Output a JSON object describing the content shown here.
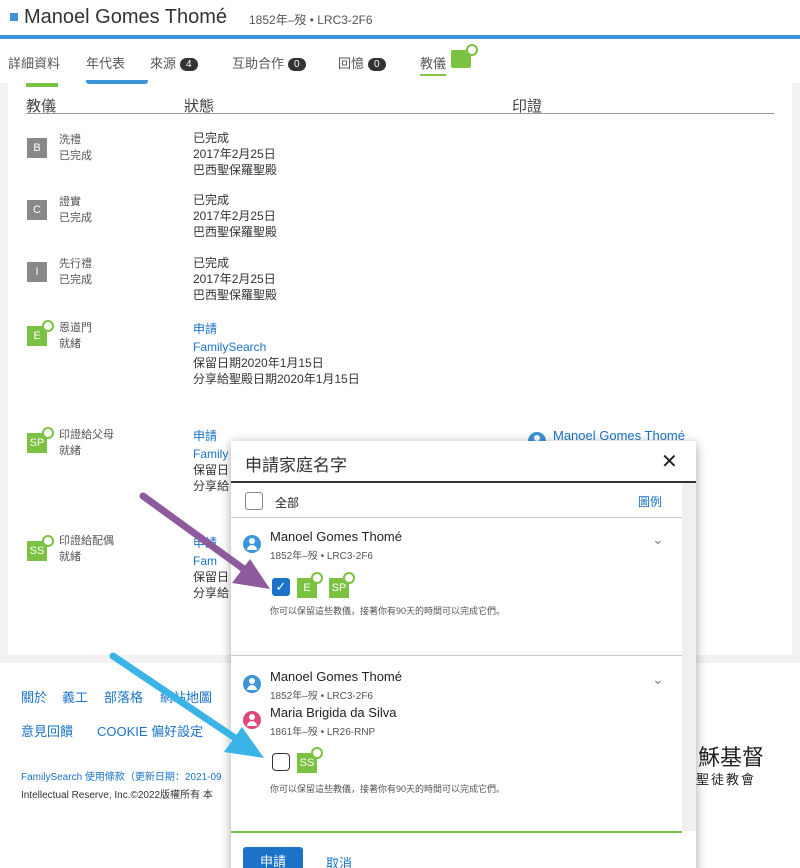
{
  "header": {
    "name": "Manoel Gomes Thomé",
    "meta": "1852年–歿 • LRC3-2F6"
  },
  "tabs": [
    {
      "label": "詳細資料"
    },
    {
      "label": "年代表"
    },
    {
      "label": "來源",
      "badge": "4"
    },
    {
      "label": "互助合作",
      "badge": "0"
    },
    {
      "label": "回憶",
      "badge": "0"
    },
    {
      "label": "教儀"
    }
  ],
  "table": {
    "col_ordinance": "教儀",
    "col_status": "狀態",
    "col_sealing": "印證"
  },
  "ordinances": [
    {
      "letter": "B",
      "name": "洗禮",
      "state": "已完成",
      "lines": [
        "已完成",
        "2017年2月25日",
        "巴西聖保羅聖殿"
      ]
    },
    {
      "letter": "C",
      "name": "證實",
      "state": "已完成",
      "lines": [
        "已完成",
        "2017年2月25日",
        "巴西聖保羅聖殿"
      ]
    },
    {
      "letter": "I",
      "name": "先行禮",
      "state": "已完成",
      "lines": [
        "已完成",
        "2017年2月25日",
        "巴西聖保羅聖殿"
      ]
    },
    {
      "letter": "E",
      "name": "恩道門",
      "state": "就緒",
      "link1": "申請",
      "link2": "FamilySearch",
      "lines": [
        "保留日期2020年1月15日",
        "分享給聖殿日期2020年1月15日"
      ]
    },
    {
      "letter": "SP",
      "name": "印證給父母",
      "state": "就緒",
      "link1": "申請",
      "link2": "Family",
      "lines": [
        "保留日",
        "分享給"
      ],
      "sealing_person": "Manoel Gomes Thomé"
    },
    {
      "letter": "SS",
      "name": "印證給配偶",
      "state": "就緒",
      "link1": "申請",
      "link2": "Fam",
      "lines": [
        "保留日",
        "分享給"
      ]
    }
  ],
  "footer": {
    "links": [
      "關於",
      "義工",
      "部落格",
      "網站地圖"
    ],
    "feedback": "意見回饋",
    "cookie": "COOKIE 偏好設定",
    "terms": "FamilySearch 使用條款（更新日期：2021-09",
    "copyright": "Intellectual Reserve, Inc.©2022版權所有 本",
    "church_line1": "穌基督",
    "church_line2": "聖徒教會"
  },
  "modal": {
    "title": "申請家庭名字",
    "close": "✕",
    "select_all": "全部",
    "legend": "圖例",
    "person1": {
      "name": "Manoel Gomes Thomé",
      "meta": "1852年–歿 • LRC3-2F6",
      "badges": [
        "E",
        "SP"
      ]
    },
    "note": "你可以保留這些教儀，接著你有90天的時間可以完成它們。",
    "person2": {
      "name": "Manoel Gomes Thomé",
      "meta": "1852年–歿 • LRC3-2F6"
    },
    "spouse": {
      "name": "Maria Brigida da Silva",
      "meta": "1861年–歿 • LR26-RNP",
      "badges": [
        "SS"
      ]
    },
    "submit": "申請",
    "cancel": "取消"
  },
  "colors": {
    "accent_blue": "#3b95d8",
    "link_blue": "#1a73c8",
    "ordinance_green": "#7bc142",
    "arrow_purple": "#8e5a9e",
    "arrow_cyan": "#3ab4e6"
  }
}
